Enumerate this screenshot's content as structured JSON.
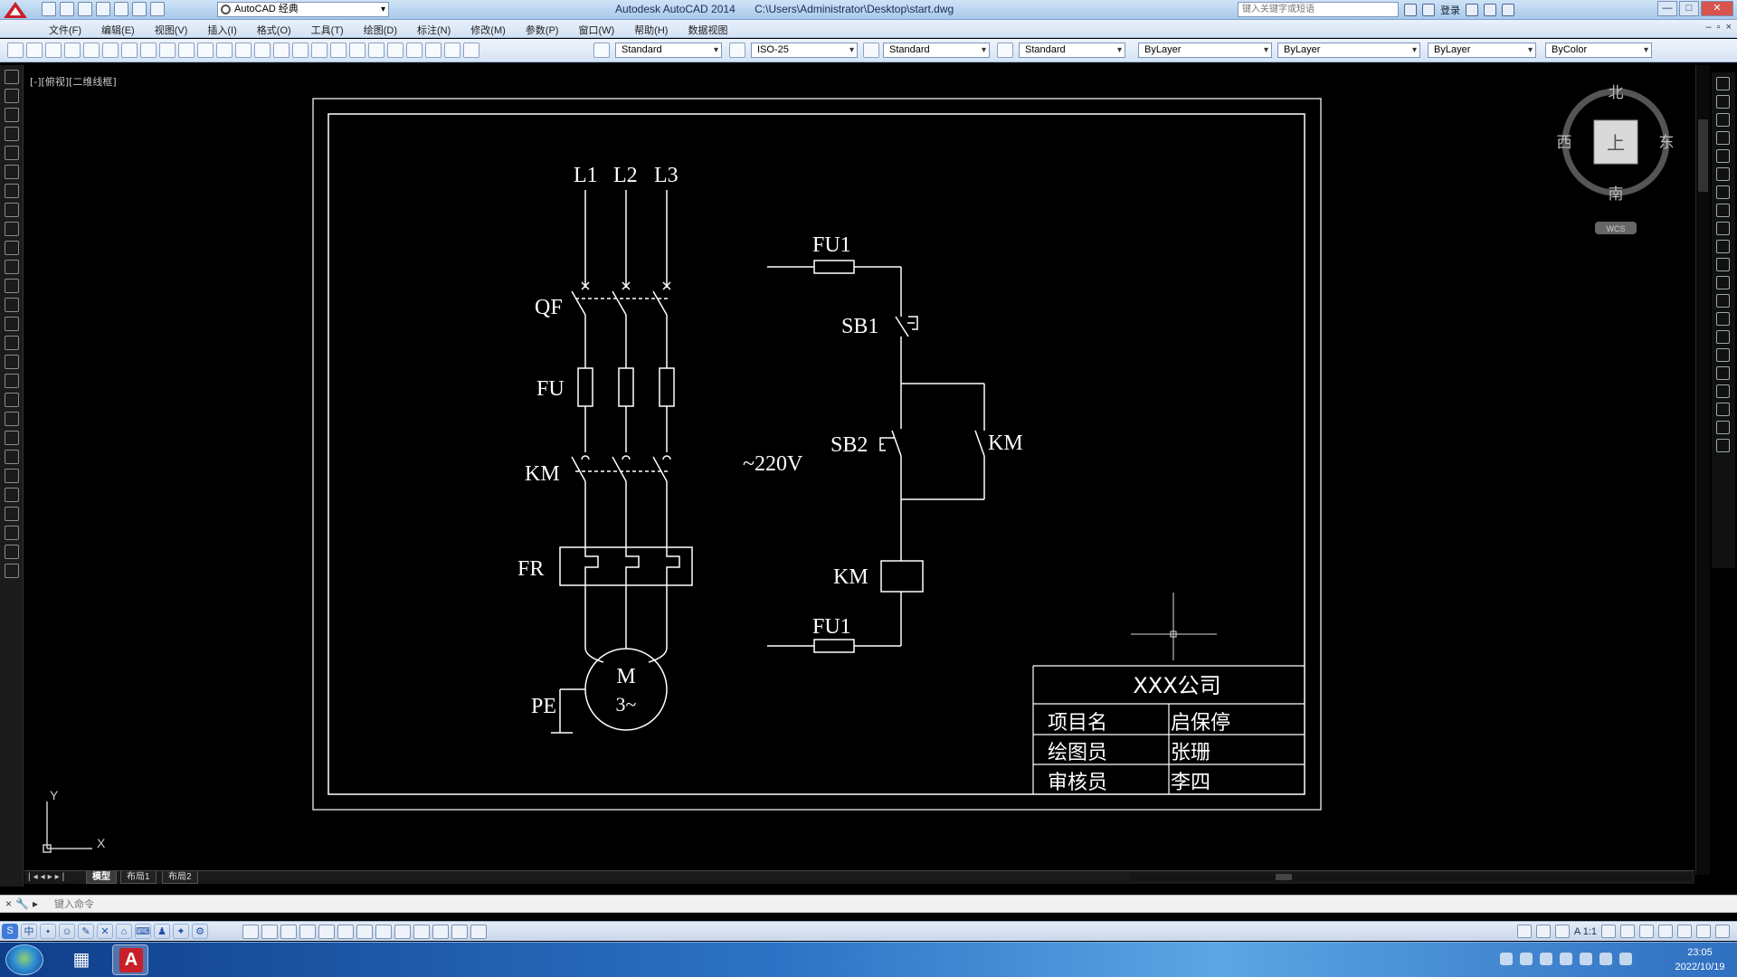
{
  "window": {
    "title_app": "Autodesk AutoCAD 2014",
    "title_file": "C:\\Users\\Administrator\\Desktop\\start.dwg",
    "workspace": "AutoCAD 经典",
    "help_search_placeholder": "键入关键字或短语",
    "sign_in": "登录",
    "controls": [
      "—",
      "□",
      "✕"
    ]
  },
  "menu": [
    "文件(F)",
    "编辑(E)",
    "视图(V)",
    "插入(I)",
    "格式(O)",
    "工具(T)",
    "绘图(D)",
    "标注(N)",
    "修改(M)",
    "参数(P)",
    "窗口(W)",
    "帮助(H)",
    "数据视图"
  ],
  "toolbar": {
    "text_style": "Standard",
    "dim_style": "ISO-25",
    "table_style": "Standard",
    "multileader_style": "Standard",
    "layer": "ByLayer",
    "linetype": "ByLayer",
    "lineweight": "ByLayer",
    "plot_style": "ByColor"
  },
  "viewport_label": "[-][俯视][二维线框]",
  "viewcube": {
    "north": "北",
    "south": "南",
    "east": "东",
    "west": "西",
    "face": "上",
    "wcs": "WCS"
  },
  "ucs": {
    "x": "X",
    "y": "Y"
  },
  "drawing": {
    "phases": [
      "L1",
      "L2",
      "L3"
    ],
    "main_labels": {
      "qf": "QF",
      "fu": "FU",
      "km": "KM",
      "fr": "FR",
      "pe": "PE"
    },
    "motor": {
      "m": "M",
      "phase": "3~"
    },
    "control_voltage": "~220V",
    "control_labels": {
      "fu1_top": "FU1",
      "sb1": "SB1",
      "sb2": "SB2",
      "km_aux": "KM",
      "km_coil": "KM",
      "fu1_bottom": "FU1"
    },
    "title_block": {
      "company": "XXX公司",
      "rows": [
        {
          "label": "项目名",
          "value": "启保停"
        },
        {
          "label": "绘图员",
          "value": "张珊"
        },
        {
          "label": "审核员",
          "value": "李四"
        }
      ]
    }
  },
  "layout_tabs": [
    "模型",
    "布局1",
    "布局2"
  ],
  "command_line": {
    "placeholder": "键入命令"
  },
  "statusbar": {
    "scale": "A 1:1",
    "ime_label": "中"
  },
  "clock": {
    "time": "23:05",
    "date": "2022/10/19"
  }
}
